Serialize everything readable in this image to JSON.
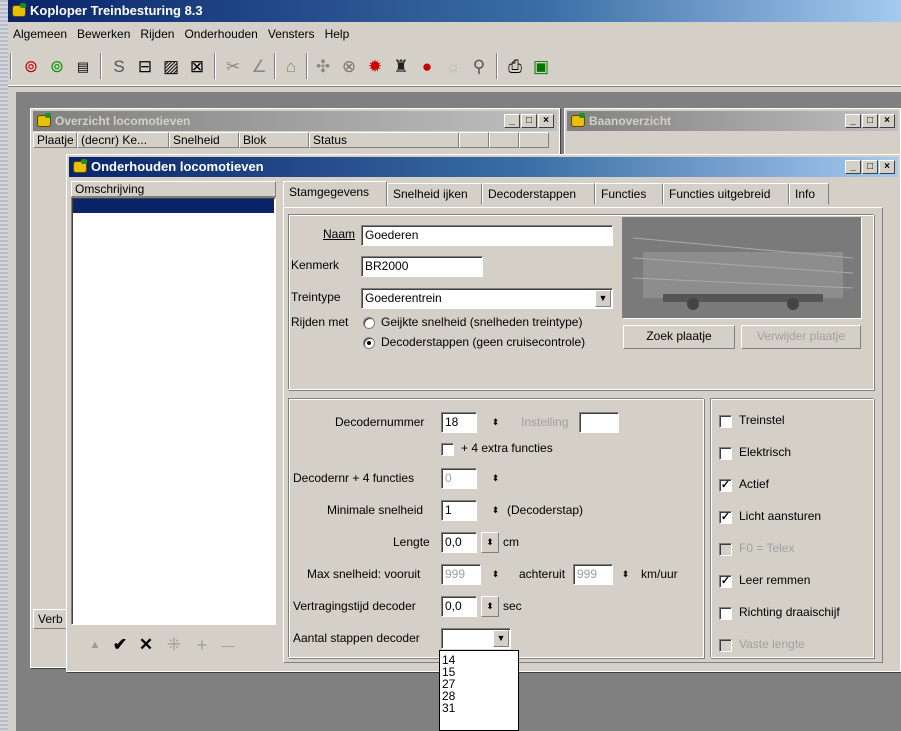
{
  "app": {
    "title": "Koploper Treinbesturing 8.3",
    "menu": [
      "Algemeen",
      "Bewerken",
      "Rijden",
      "Onderhouden",
      "Vensters",
      "Help"
    ]
  },
  "toolbar": {
    "icons": [
      "signal-icon",
      "signal-green-icon",
      "panel-icon",
      "s-icon",
      "block-icon",
      "edit-icon",
      "delete-icon",
      "tool-icon",
      "curve-icon",
      "station-icon",
      "junction-icon",
      "hazard-icon",
      "sound-icon",
      "locomotive-icon",
      "stop-icon",
      "light-icon",
      "switch-icon",
      "printer-icon",
      "save-icon"
    ]
  },
  "overview_window": {
    "title": "Overzicht locomotieven",
    "columns": [
      "Plaatje",
      "(decnr) Ke...",
      "Snelheid",
      "Blok",
      "Status"
    ],
    "bottom_label": "Verb"
  },
  "baan_window": {
    "title": "Baanoverzicht"
  },
  "dialog": {
    "title": "Onderhouden locomotieven",
    "list_header": "Omschrijving",
    "list_toolbar": [
      "▲",
      "✔",
      "✕",
      "⁜",
      "+",
      "—"
    ],
    "tabs": [
      "Stamgegevens",
      "Snelheid ijken",
      "Decoderstappen",
      "Functies",
      "Functies uitgebreid",
      "Info"
    ],
    "stam": {
      "naam_label": "Naam",
      "naam_value": "Goederen",
      "kenmerk_label": "Kenmerk",
      "kenmerk_value": "BR2000",
      "treintype_label": "Treintype",
      "treintype_value": "Goederentrein",
      "rijden_met_label": "Rijden met",
      "radio1": "Geijkte snelheid (snelheden treintype)",
      "radio2": "Decoderstappen (geen cruisecontrole)",
      "zoek_button": "Zoek plaatje",
      "verwijder_button": "Verwijder plaatje"
    },
    "decoder": {
      "decodernummer_label": "Decodernummer",
      "decodernummer_value": "18",
      "instelling_label": "Instelling",
      "instelling_value": "",
      "extra_functies_label": "+ 4 extra functies",
      "decodernr4_label": "Decodernr + 4 functies",
      "decodernr4_value": "0",
      "min_snelheid_label": "Minimale snelheid",
      "min_snelheid_value": "1",
      "min_snelheid_unit": "(Decoderstap)",
      "lengte_label": "Lengte",
      "lengte_value": "0,0",
      "lengte_unit": "cm",
      "max_label": "Max snelheid: vooruit",
      "max_vooruit_value": "999",
      "achteruit_label": "achteruit",
      "max_achteruit_value": "999",
      "max_unit": "km/uur",
      "vertraging_label": "Vertragingstijd decoder",
      "vertraging_value": "0,0",
      "vertraging_unit": "sec",
      "stappen_label": "Aantal stappen decoder",
      "stappen_value": "",
      "stappen_options": [
        "14",
        "15",
        "27",
        "28",
        "31"
      ]
    },
    "checks": [
      {
        "label": "Treinstel",
        "checked": false,
        "disabled": false
      },
      {
        "label": "Elektrisch",
        "checked": false,
        "disabled": false
      },
      {
        "label": "Actief",
        "checked": true,
        "disabled": false
      },
      {
        "label": "Licht aansturen",
        "checked": true,
        "disabled": false
      },
      {
        "label": "F0 = Telex",
        "checked": false,
        "disabled": true
      },
      {
        "label": "Leer remmen",
        "checked": true,
        "disabled": false
      },
      {
        "label": "Richting draaischijf",
        "checked": false,
        "disabled": false
      },
      {
        "label": "Vaste lengte",
        "checked": false,
        "disabled": true
      }
    ]
  }
}
